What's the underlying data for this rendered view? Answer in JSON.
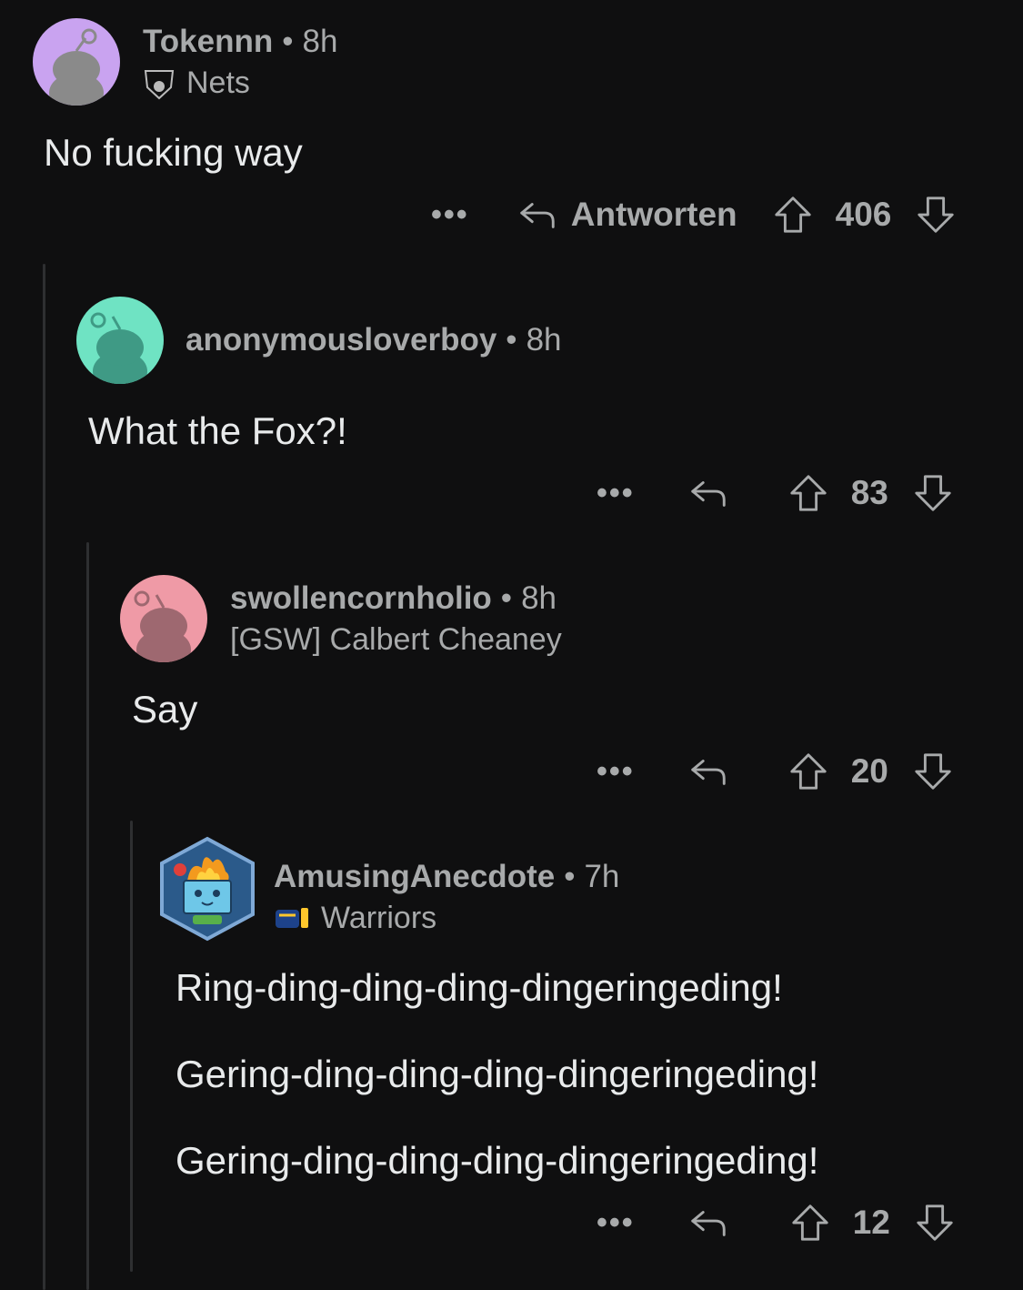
{
  "comments": [
    {
      "username": "Tokennn",
      "time": "8h",
      "flair": "Nets",
      "flair_icon": "nets-logo-icon",
      "avatar_color": "#c9a3f0",
      "body": [
        "No fucking way"
      ],
      "reply_label": "Antworten",
      "score": "406"
    },
    {
      "username": "anonymousloverboy",
      "time": "8h",
      "avatar_color": "#6fe3c3",
      "body": [
        "What the Fox?!"
      ],
      "score": "83"
    },
    {
      "username": "swollencornholio",
      "time": "8h",
      "flair": "[GSW] Calbert Cheaney",
      "avatar_color": "#ef9aa6",
      "body": [
        "Say"
      ],
      "score": "20"
    },
    {
      "username": "AmusingAnecdote",
      "time": "7h",
      "flair": "Warriors",
      "flair_icon": "warriors-logo-icon",
      "avatar_icon": "burning-dumpster-avatar-icon",
      "body": [
        "Ring-ding-ding-ding-dingeringeding!",
        "Gering-ding-ding-ding-dingeringeding!",
        "Gering-ding-ding-ding-dingeringeding!"
      ],
      "score": "12"
    }
  ],
  "more_label": "•••",
  "sep": "•"
}
